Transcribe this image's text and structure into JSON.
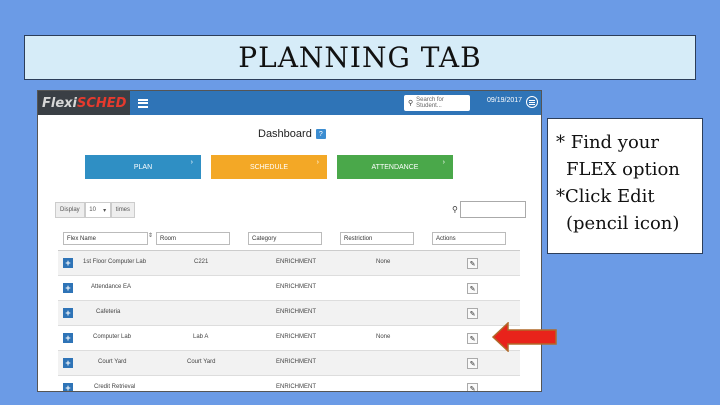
{
  "slide_title": "PLANNING TAB",
  "note": {
    "line1": "* Find your",
    "line2": "FLEX option",
    "line3": "*Click Edit",
    "line4": "(pencil icon)"
  },
  "app": {
    "logo_flexi": "Flexi",
    "logo_sched": "SCHED",
    "search_placeholder": "Search for Student...",
    "date": "09/19/2017",
    "dashboard_title": "Dashboard",
    "help_icon": "?",
    "buttons": [
      {
        "label": "PLAN",
        "color": "#2f8fc4"
      },
      {
        "label": "SCHEDULE",
        "color": "#f3a826"
      },
      {
        "label": "ATTENDANCE",
        "color": "#4aa84a"
      }
    ],
    "display_label": "Display",
    "display_value": "10",
    "times_label": "times",
    "columns": [
      "Flex Name",
      "Room",
      "Category",
      "Restriction",
      "Actions"
    ],
    "rows": [
      {
        "name": "1st Floor Computer Lab",
        "room": "C221",
        "category": "ENRICHMENT",
        "restriction": "None"
      },
      {
        "name": "Attendance EA",
        "room": "",
        "category": "ENRICHMENT",
        "restriction": ""
      },
      {
        "name": "Cafeteria",
        "room": "",
        "category": "ENRICHMENT",
        "restriction": ""
      },
      {
        "name": "Computer Lab",
        "room": "Lab A",
        "category": "ENRICHMENT",
        "restriction": "None"
      },
      {
        "name": "Court Yard",
        "room": "Court Yard",
        "category": "ENRICHMENT",
        "restriction": ""
      },
      {
        "name": "Credit Retrieval",
        "room": "",
        "category": "ENRICHMENT",
        "restriction": ""
      }
    ]
  },
  "arrow_color": "#e8231b",
  "icons": {
    "edit": "pencil-icon",
    "expand": "plus-icon",
    "search": "search-icon",
    "menu": "hamburger-icon"
  }
}
